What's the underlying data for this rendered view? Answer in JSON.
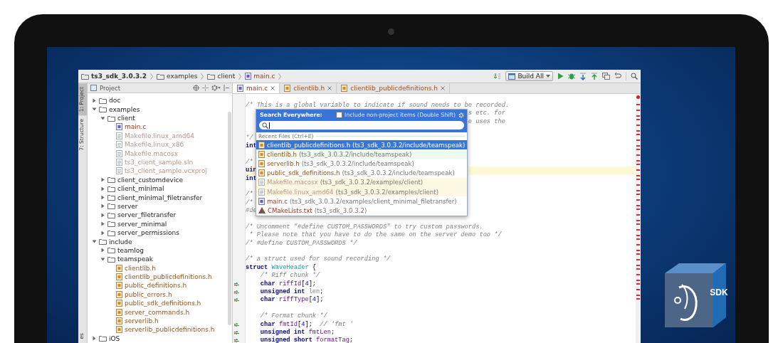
{
  "breadcrumb": [
    {
      "label": "ts3_sdk_3.0.3.2",
      "kind": "root"
    },
    {
      "label": "examples",
      "kind": "folder"
    },
    {
      "label": "client",
      "kind": "folder"
    },
    {
      "label": "main.c",
      "kind": "file"
    }
  ],
  "toolbar": {
    "build_config": "Build All"
  },
  "side_strip": [
    {
      "label": "1: Project",
      "selected": true,
      "kind": "top"
    },
    {
      "label": "7: Structure",
      "selected": false,
      "kind": "top"
    },
    {
      "label": "es",
      "selected": false,
      "kind": "bottom"
    }
  ],
  "project_panel": {
    "title": "Project",
    "tree": [
      {
        "name": "doc",
        "kind": "folder",
        "expanded": false
      },
      {
        "name": "examples",
        "kind": "folder",
        "expanded": true,
        "children": [
          {
            "name": "client",
            "kind": "folder",
            "expanded": true,
            "children": [
              {
                "name": "main.c",
                "kind": "c-file"
              },
              {
                "name": "Makefile.linux_amd64",
                "kind": "plain-file"
              },
              {
                "name": "Makefile.linux_x86",
                "kind": "plain-file"
              },
              {
                "name": "Makefile.macosx",
                "kind": "plain-file"
              },
              {
                "name": "ts3_client_sample.sln",
                "kind": "plain-file"
              },
              {
                "name": "ts3_client_sample.vcxproj",
                "kind": "plain-file"
              }
            ]
          },
          {
            "name": "client_customdevice",
            "kind": "folder",
            "expanded": false
          },
          {
            "name": "client_minimal",
            "kind": "folder",
            "expanded": false
          },
          {
            "name": "client_minimal_filetransfer",
            "kind": "folder",
            "expanded": false
          },
          {
            "name": "server",
            "kind": "folder",
            "expanded": false
          },
          {
            "name": "server_filetransfer",
            "kind": "folder",
            "expanded": false
          },
          {
            "name": "server_minimal",
            "kind": "folder",
            "expanded": false
          },
          {
            "name": "server_permissions",
            "kind": "folder",
            "expanded": false
          }
        ]
      },
      {
        "name": "include",
        "kind": "folder",
        "expanded": true,
        "children": [
          {
            "name": "teamlog",
            "kind": "folder",
            "expanded": false
          },
          {
            "name": "teamspeak",
            "kind": "folder",
            "expanded": true,
            "children": [
              {
                "name": "clientlib.h",
                "kind": "h-file"
              },
              {
                "name": "clientlib_publicdefinitions.h",
                "kind": "h-file"
              },
              {
                "name": "public_definitions.h",
                "kind": "h-file"
              },
              {
                "name": "public_errors.h",
                "kind": "h-file"
              },
              {
                "name": "public_sdk_definitions.h",
                "kind": "h-file"
              },
              {
                "name": "server_commands.h",
                "kind": "h-file"
              },
              {
                "name": "serverlib.h",
                "kind": "h-file"
              },
              {
                "name": "serverlib_publicdefinitions.h",
                "kind": "h-file"
              }
            ]
          }
        ]
      },
      {
        "name": "iOS",
        "kind": "folder",
        "expanded": false
      }
    ]
  },
  "tabs": [
    {
      "label": "main.c",
      "kind": "c-file",
      "selected": true
    },
    {
      "label": "clientlib.h",
      "kind": "h-file",
      "selected": false
    },
    {
      "label": "clientlib_publicdefinitions.h",
      "kind": "h-file",
      "selected": false
    }
  ],
  "code": [
    {
      "kind": "code",
      "tokens": [
        {
          "kind": "comment",
          "text": "/* This is a global variable to indicate if sound needs to be recorded."
        }
      ]
    },
    {
      "kind": "code",
      "right": [
        {
          "kind": "comment",
          "text": "s etc. for"
        }
      ]
    },
    {
      "kind": "code",
      "right": [
        {
          "kind": "comment",
          "text": "e uses the"
        }
      ]
    },
    {
      "kind": "blank"
    },
    {
      "kind": "code",
      "tokens": [
        {
          "kind": "comment",
          "text": "*/"
        }
      ]
    },
    {
      "kind": "code",
      "tokens": [
        {
          "kind": "keyword",
          "text": "int"
        }
      ]
    },
    {
      "kind": "blank"
    },
    {
      "kind": "code",
      "tokens": [
        {
          "kind": "comment",
          "text": "/*"
        }
      ]
    },
    {
      "kind": "code",
      "highlighted": true,
      "tokens": [
        {
          "kind": "keyword",
          "text": "uin"
        }
      ]
    },
    {
      "kind": "code",
      "tokens": [
        {
          "kind": "keyword",
          "text": "int"
        }
      ]
    },
    {
      "kind": "blank"
    },
    {
      "kind": "code",
      "tokens": [
        {
          "kind": "comment",
          "text": "/*"
        }
      ]
    },
    {
      "kind": "code",
      "tokens": [
        {
          "kind": "comment",
          "text": "/*"
        }
      ]
    },
    {
      "kind": "code",
      "tokens": [
        {
          "kind": "comment",
          "text": "#de"
        }
      ]
    },
    {
      "kind": "blank"
    },
    {
      "kind": "code",
      "tokens": [
        {
          "kind": "comment",
          "text": "/* Uncomment \"#define CUSTOM_PASSWORDS\" to try custom passwords."
        }
      ]
    },
    {
      "kind": "code",
      "tokens": [
        {
          "kind": "comment",
          "text": " * Please note that you have to do the same on the server demo too */"
        }
      ]
    },
    {
      "kind": "code",
      "tokens": [
        {
          "kind": "comment",
          "text": "/* #define CUSTOM_PASSWORDS */"
        }
      ]
    },
    {
      "kind": "blank"
    },
    {
      "kind": "code",
      "tokens": [
        {
          "kind": "comment",
          "text": "/* a struct used for sound recording */"
        }
      ]
    },
    {
      "kind": "code",
      "tokens": [
        {
          "kind": "keyword",
          "text": "struct"
        },
        {
          "kind": "type",
          "text": " WaveHeader"
        },
        {
          "kind": "plain",
          "text": " {"
        }
      ]
    },
    {
      "kind": "code",
      "tokens": [
        {
          "kind": "comment",
          "text": "    /* Riff chunk */"
        }
      ]
    },
    {
      "kind": "code",
      "changed": true,
      "tokens": [
        {
          "kind": "keyword",
          "text": "    char"
        },
        {
          "kind": "field",
          "text": " riffId"
        },
        {
          "kind": "plain",
          "text": "["
        },
        {
          "kind": "number",
          "text": "4"
        },
        {
          "kind": "plain",
          "text": "];"
        }
      ]
    },
    {
      "kind": "code",
      "changed": true,
      "tokens": [
        {
          "kind": "keyword",
          "text": "    unsigned int"
        },
        {
          "kind": "unused",
          "text": " len"
        },
        {
          "kind": "plain",
          "text": ";"
        }
      ]
    },
    {
      "kind": "code",
      "changed": true,
      "tokens": [
        {
          "kind": "keyword",
          "text": "    char"
        },
        {
          "kind": "field",
          "text": " riffType"
        },
        {
          "kind": "plain",
          "text": "["
        },
        {
          "kind": "number",
          "text": "4"
        },
        {
          "kind": "plain",
          "text": "];"
        }
      ]
    },
    {
      "kind": "blank"
    },
    {
      "kind": "code",
      "tokens": [
        {
          "kind": "comment",
          "text": "    /* Format chunk */"
        }
      ]
    },
    {
      "kind": "code",
      "changed": true,
      "tokens": [
        {
          "kind": "keyword",
          "text": "    char"
        },
        {
          "kind": "field",
          "text": " fmtId"
        },
        {
          "kind": "plain",
          "text": "["
        },
        {
          "kind": "number",
          "text": "4"
        },
        {
          "kind": "plain",
          "text": "];"
        },
        {
          "kind": "comment",
          "text": "  // 'fmt '"
        }
      ]
    },
    {
      "kind": "code",
      "changed": true,
      "tokens": [
        {
          "kind": "keyword",
          "text": "    unsigned int"
        },
        {
          "kind": "field",
          "text": " fmtLen"
        },
        {
          "kind": "plain",
          "text": ";"
        }
      ]
    },
    {
      "kind": "code",
      "changed": true,
      "tokens": [
        {
          "kind": "keyword",
          "text": "    unsigned short"
        },
        {
          "kind": "field",
          "text": " formatTag"
        },
        {
          "kind": "plain",
          "text": ";"
        }
      ]
    }
  ],
  "search_popup": {
    "title": "Search Everywhere:",
    "include_non_project": {
      "label": "Include non-project items (Double Shift)",
      "checked": false
    },
    "section": "Recent Files (Ctrl+E)",
    "results": [
      {
        "name": "clientlib_publicdefinitions.h",
        "path": "(ts3_sdk_3.0.3.2/include/teamspeak)",
        "kind": "h-file",
        "selected": true,
        "color": "#3875d7"
      },
      {
        "name": "clientlib.h",
        "path": "(ts3_sdk_3.0.3.2/include/teamspeak)",
        "kind": "h-file",
        "selected": false,
        "color": "#eefaee"
      },
      {
        "name": "serverlib.h",
        "path": "(ts3_sdk_3.0.3.2/include/teamspeak)",
        "kind": "h-file",
        "selected": false,
        "color": "#ffffff"
      },
      {
        "name": "public_sdk_definitions.h",
        "path": "(ts3_sdk_3.0.3.2/include/teamspeak)",
        "kind": "h-file",
        "selected": false,
        "color": "#ffffff"
      },
      {
        "name": "Makefile.macosx",
        "path": "(ts3_sdk_3.0.3.2/examples/client)",
        "kind": "plain-file",
        "selected": false,
        "color": "#fdf8e2"
      },
      {
        "name": "Makefile.linux_amd64",
        "path": "(ts3_sdk_3.0.3.2/examples/client)",
        "kind": "plain-file",
        "selected": false,
        "color": "#fdf8e2"
      },
      {
        "name": "main.c",
        "path": "(ts3_sdk_3.0.3.2/examples/client_minimal_filetransfer)",
        "kind": "c-file",
        "selected": false,
        "color": "#ffffff"
      },
      {
        "name": "CMakeLists.txt",
        "path": "(ts3_sdk_3.0.3.2)",
        "kind": "cmake-file",
        "selected": false,
        "color": "#ffffff"
      }
    ]
  },
  "badge": {
    "label": "SDK"
  }
}
